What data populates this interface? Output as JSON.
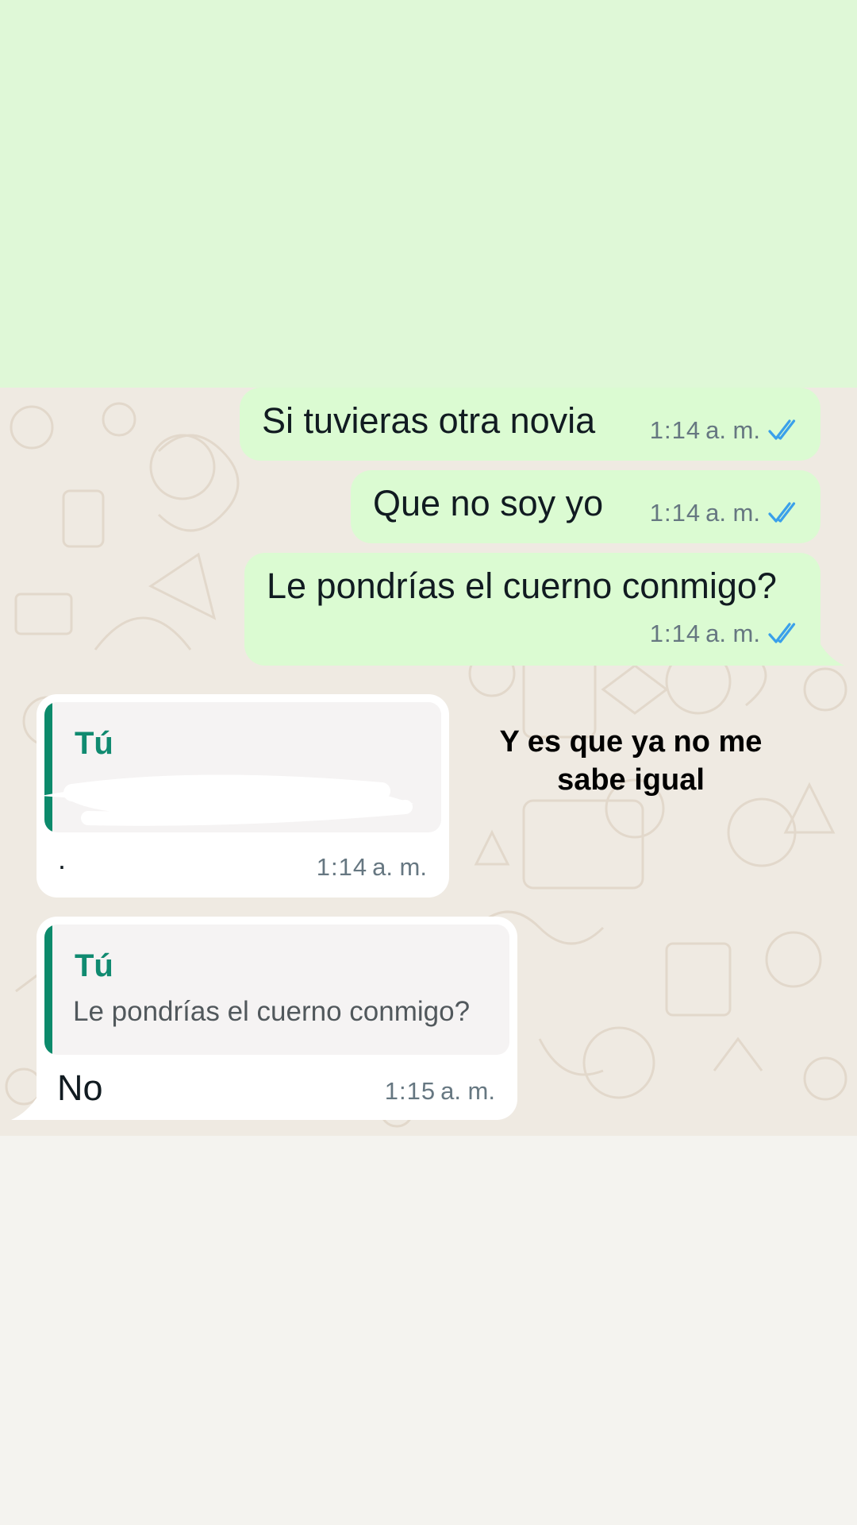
{
  "messages_out": [
    {
      "text": "Si tuvieras otra novia",
      "time": "1:14",
      "ampm": "a. m."
    },
    {
      "text": "Que no soy yo",
      "time": "1:14",
      "ampm": "a. m."
    },
    {
      "text": "Le pondrías el cuerno conmigo?",
      "time": "1:14",
      "ampm": "a. m."
    }
  ],
  "reply_1": {
    "quote_author": "Tú",
    "text": "·",
    "time": "1:14",
    "ampm": "a. m."
  },
  "reply_2": {
    "quote_author": "Tú",
    "quote_text": "Le pondrías el cuerno conmigo?",
    "text": "No",
    "time": "1:15",
    "ampm": "a. m."
  },
  "caption": {
    "line1": "Y es que ya no me",
    "line2": "sabe igual"
  },
  "colors": {
    "outgoing_bubble": "#dbfbd2",
    "incoming_bubble": "#ffffff",
    "quote_accent": "#0c8a6b",
    "read_ticks": "#3aa0ea",
    "chat_background": "#efeae2"
  },
  "icons": {
    "read_receipt": "double-check-icon"
  }
}
